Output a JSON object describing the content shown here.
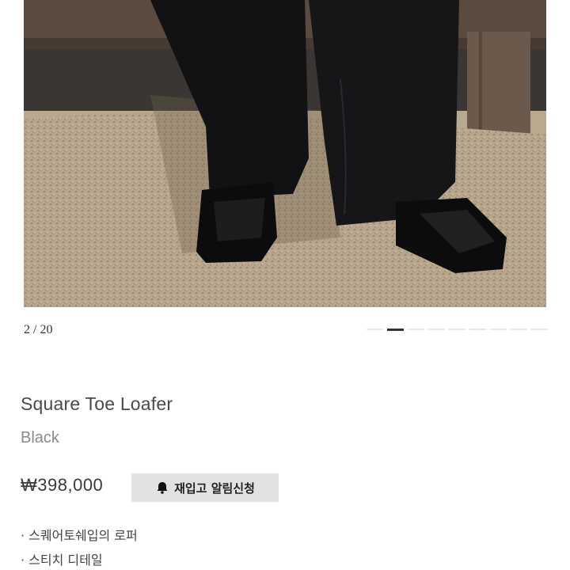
{
  "gallery": {
    "counter": "2 / 20",
    "total_dots": 9,
    "active_dot": 1
  },
  "product": {
    "name": "Square Toe Loafer",
    "color": "Black",
    "price": "₩398,000"
  },
  "restock": {
    "label": "재입고 알림신청",
    "icon": "bell-icon"
  },
  "features": [
    "· 스퀘어토쉐입의 로퍼",
    "· 스티치 디테일"
  ],
  "colors": {
    "text_dark": "#333333",
    "text_muted": "#8a8a8a",
    "button_bg": "#e2e2e2",
    "active_indicator": "#333333"
  }
}
